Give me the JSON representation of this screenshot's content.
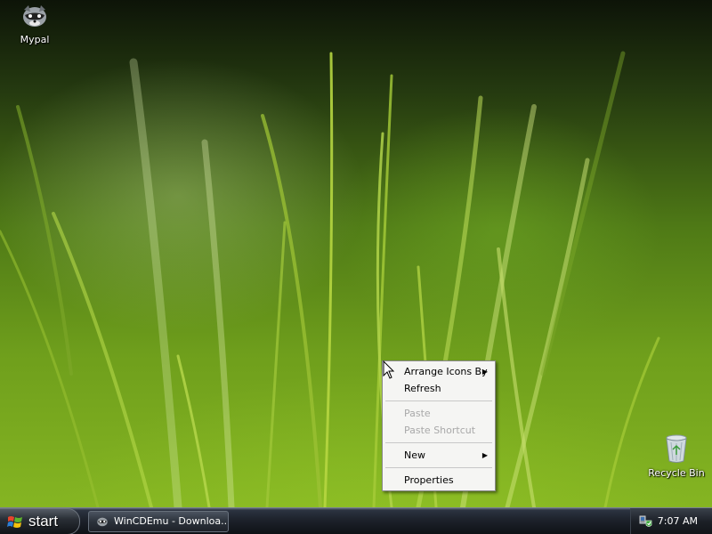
{
  "desktop": {
    "icons": [
      {
        "label": "Mypal",
        "icon": "raccoon-icon"
      },
      {
        "label": "Recycle Bin",
        "icon": "recycle-bin-icon"
      }
    ]
  },
  "context_menu": {
    "items": [
      {
        "label": "Arrange Icons By",
        "submenu": true,
        "enabled": true
      },
      {
        "label": "Refresh",
        "submenu": false,
        "enabled": true
      },
      {
        "label": "Paste",
        "submenu": false,
        "enabled": false
      },
      {
        "label": "Paste Shortcut",
        "submenu": false,
        "enabled": false
      },
      {
        "label": "New",
        "submenu": true,
        "enabled": true
      },
      {
        "label": "Properties",
        "submenu": false,
        "enabled": true
      }
    ],
    "submenu_arrow": "▶"
  },
  "taskbar": {
    "start_label": "start",
    "tasks": [
      {
        "label": "WinCDEmu - Downloa...",
        "icon": "raccoon-icon"
      }
    ],
    "tray": {
      "icons": [
        "network-shield-icon"
      ],
      "clock": "7:07 AM"
    }
  },
  "colors": {
    "menu_background": "#f5f5f3",
    "disabled_text": "#a9a9a9",
    "taskbar_dark": "#1d222b",
    "grass_green": "#85b522"
  }
}
